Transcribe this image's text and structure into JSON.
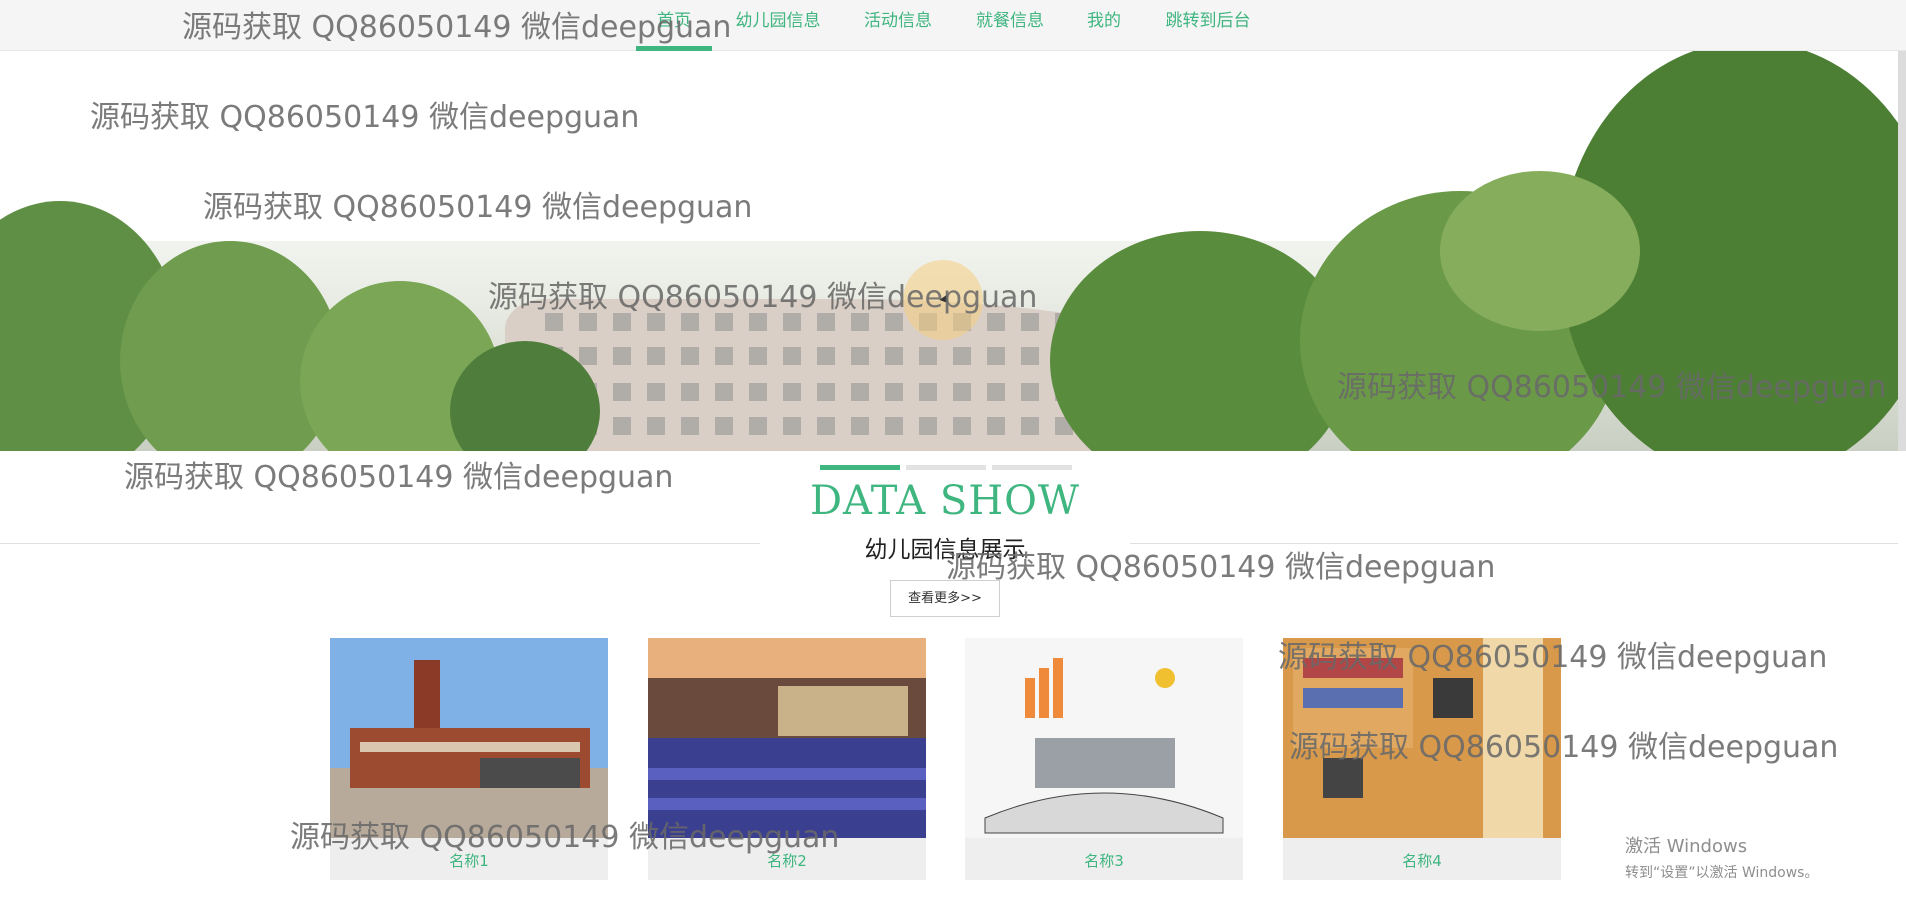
{
  "nav": {
    "items": [
      {
        "label": "首页",
        "active": true
      },
      {
        "label": "幼儿园信息"
      },
      {
        "label": "活动信息"
      },
      {
        "label": "就餐信息"
      },
      {
        "label": "我的"
      },
      {
        "label": "跳转到后台"
      }
    ]
  },
  "section": {
    "title": "DATA SHOW",
    "subtitle": "幼儿园信息展示",
    "more_label": "查看更多>>"
  },
  "slider": {
    "count": 3,
    "active_index": 0
  },
  "cards": [
    {
      "name": "名称1"
    },
    {
      "name": "名称2"
    },
    {
      "name": "名称3"
    },
    {
      "name": "名称4"
    }
  ],
  "watermark": "源码获取 QQ86050149 微信deepguan",
  "windows_activation": {
    "line1": "激活 Windows",
    "line2": "转到“设置”以激活 Windows。"
  },
  "colors": {
    "accent": "#3fb57f"
  }
}
